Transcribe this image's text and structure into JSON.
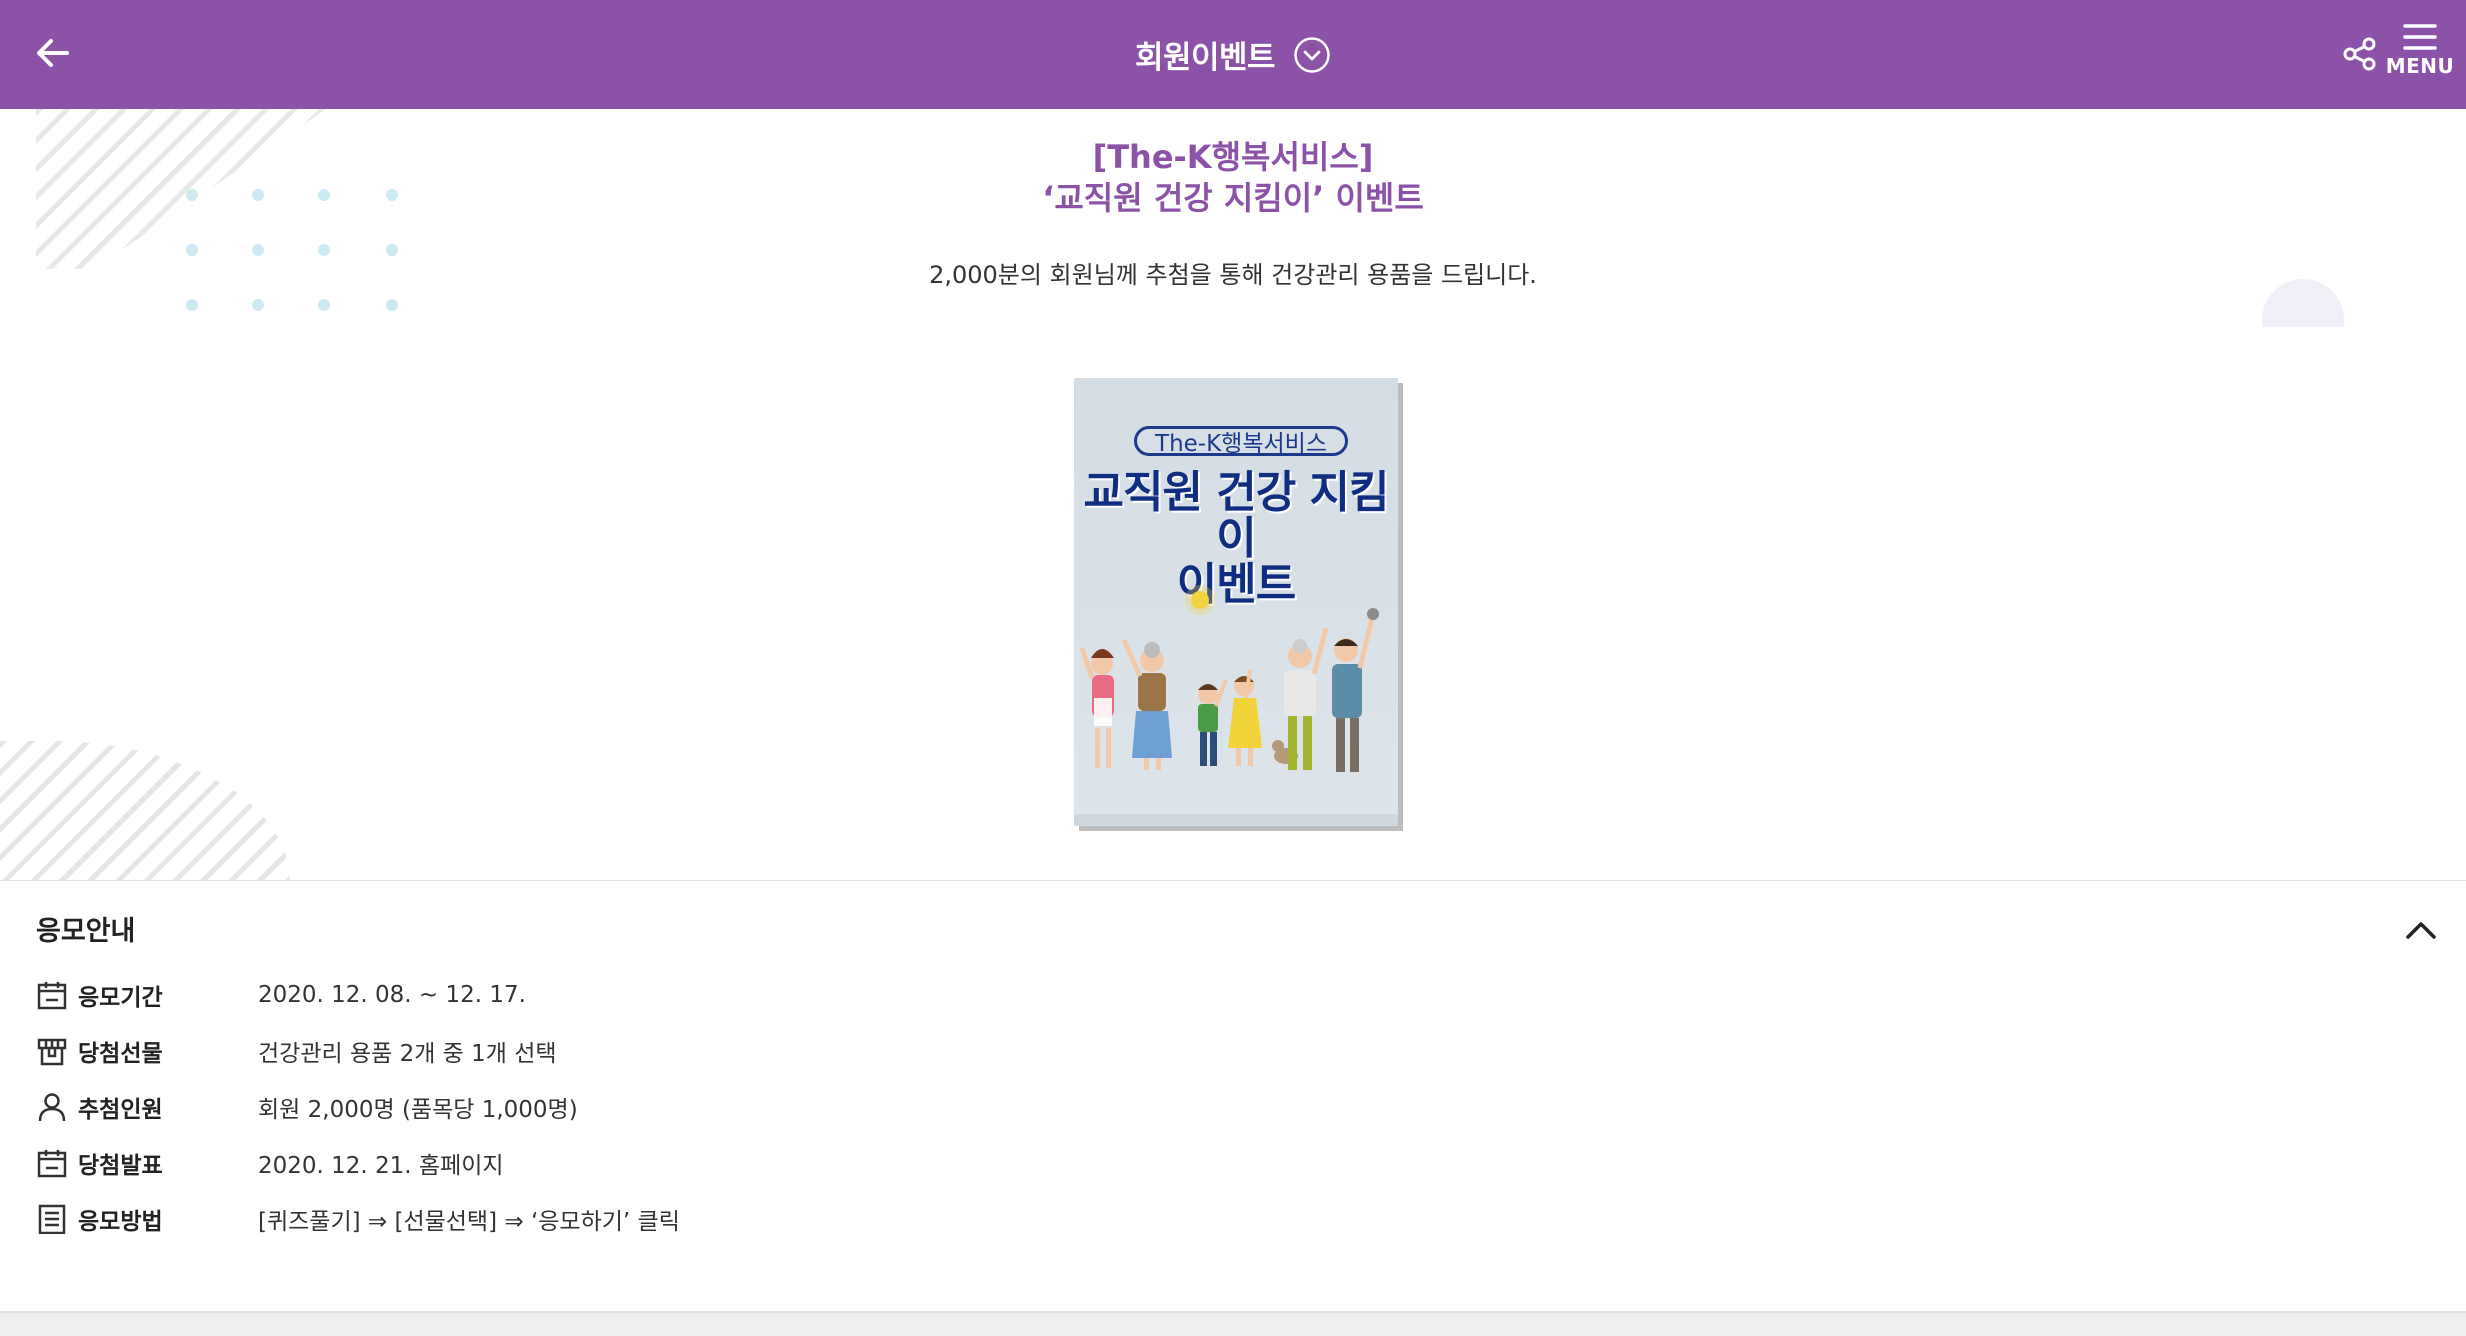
{
  "header": {
    "title": "회원이벤트",
    "menu_label": "MENU",
    "icons": [
      "back-arrow-icon",
      "chevron-down-circle-icon",
      "share-icon",
      "hamburger-menu-icon"
    ]
  },
  "colors": {
    "brand": "#8c52a8",
    "poster_title": "#0f2e82"
  },
  "hero": {
    "title_line1": "[The-K행복서비스]",
    "title_line2": "‘교직원 건강 지킴이’ 이벤트",
    "subtitle": "2,000분의 회원님께 추첨을 통해 건강관리 용품을 드립니다."
  },
  "poster": {
    "brand": "The-K행복서비스",
    "title_line1": "교직원 건강 지킴이",
    "title_line2": "이벤트"
  },
  "info": {
    "title": "응모안내",
    "rows": [
      {
        "icon": "calendar-icon",
        "label": "응모기간",
        "value": "2020. 12. 08. ~ 12. 17."
      },
      {
        "icon": "gift-shop-icon",
        "label": "당첨선물",
        "value": "건강관리 용품 2개 중 1개 선택"
      },
      {
        "icon": "person-icon",
        "label": "추첨인원",
        "value": "회원 2,000명 (품목당 1,000명)"
      },
      {
        "icon": "calendar-icon",
        "label": "당첨발표",
        "value": "2020. 12. 21. 홈페이지"
      },
      {
        "icon": "document-list-icon",
        "label": "응모방법",
        "value": "[퀴즈풀기] ⇒ [선물선택] ⇒ ‘응모하기’ 클릭"
      }
    ]
  }
}
